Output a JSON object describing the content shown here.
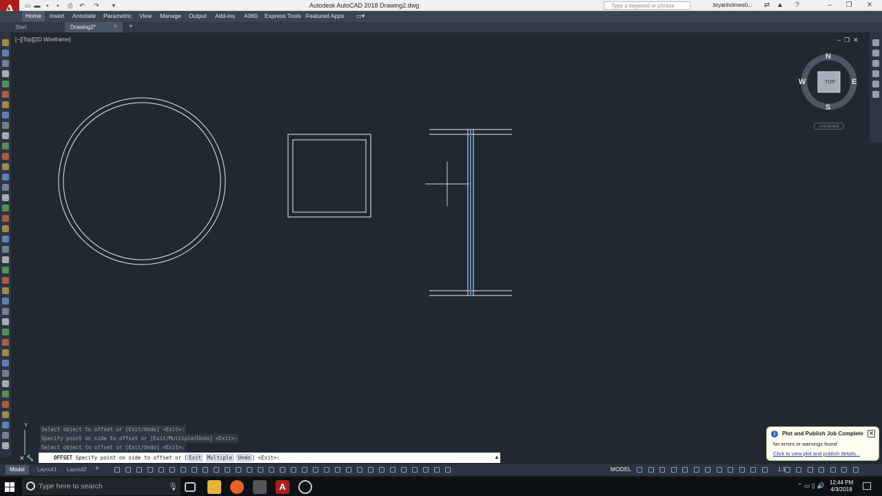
{
  "app": {
    "logo": "A",
    "title": "Autodesk AutoCAD 2018   Drawing2.dwg"
  },
  "search": {
    "placeholder": "Type a keyword or phrase"
  },
  "user": {
    "name": "bryanholmes0..."
  },
  "ribbon_tabs": [
    "Home",
    "Insert",
    "Annotate",
    "Parametric",
    "View",
    "Manage",
    "Output",
    "Add-ins",
    "A360",
    "Express Tools",
    "Featured Apps"
  ],
  "file_tabs": [
    "Start",
    "Drawing2*"
  ],
  "viewport": {
    "label": "[−][Top][2D Wireframe]"
  },
  "viewcube": {
    "n": "N",
    "s": "S",
    "e": "E",
    "w": "W",
    "top": "TOP",
    "ucs": "Unnamed"
  },
  "ucs_icon": {
    "y": "Y"
  },
  "command_history": [
    "Select object to offset or [Exit/Undo] <Exit>:",
    "Specify point on side to offset or [Exit/Multiple/Undo] <Exit>:",
    "Select object to offset or [Exit/Undo] <Exit>:"
  ],
  "command_line": {
    "cmd": "OFFSET",
    "prompt": "Specify point on side to offset or [",
    "opt1": "Exit",
    "opt2": "Multiple",
    "opt3": "Undo",
    "suffix": "] <Exit>:"
  },
  "layout_tabs": [
    "Model",
    "Layout1",
    "Layout2"
  ],
  "status": {
    "model": "MODEL",
    "scale": "1:1"
  },
  "notification": {
    "title": "Plot and Publish Job Complete",
    "message": "No errors or warnings found",
    "link": "Click to view plot and publish details..."
  },
  "taskbar": {
    "search_placeholder": "Type here to search",
    "time": "12:44 PM",
    "date": "4/3/2018"
  },
  "colors": {
    "canvas": "#212830",
    "accent_red": "#b11c1c",
    "ribbon": "#3b4453"
  }
}
